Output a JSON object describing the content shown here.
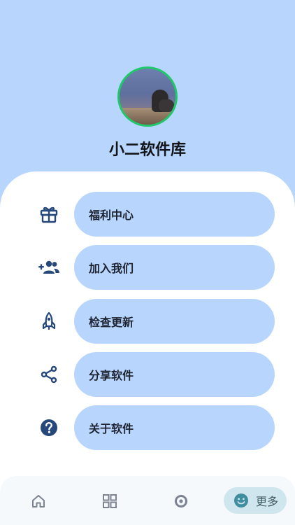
{
  "profile": {
    "app_name": "小二软件库"
  },
  "menu": {
    "items": [
      {
        "icon": "gift-icon",
        "label": "福利中心"
      },
      {
        "icon": "add-group-icon",
        "label": "加入我们"
      },
      {
        "icon": "rocket-icon",
        "label": "检查更新"
      },
      {
        "icon": "share-icon",
        "label": "分享软件"
      },
      {
        "icon": "help-icon",
        "label": "关于软件"
      }
    ]
  },
  "bottom_nav": {
    "items": [
      {
        "icon": "home-icon",
        "label": ""
      },
      {
        "icon": "grid-icon",
        "label": ""
      },
      {
        "icon": "gear-ring-icon",
        "label": ""
      },
      {
        "icon": "smiley-icon",
        "label": "更多",
        "active": true
      }
    ]
  },
  "colors": {
    "header_bg": "#b8d6fd",
    "pill_bg": "#b8d6fd",
    "icon_color": "#25477a",
    "avatar_ring": "#1fc96a",
    "nav_active_bg": "#cfe6ee"
  }
}
